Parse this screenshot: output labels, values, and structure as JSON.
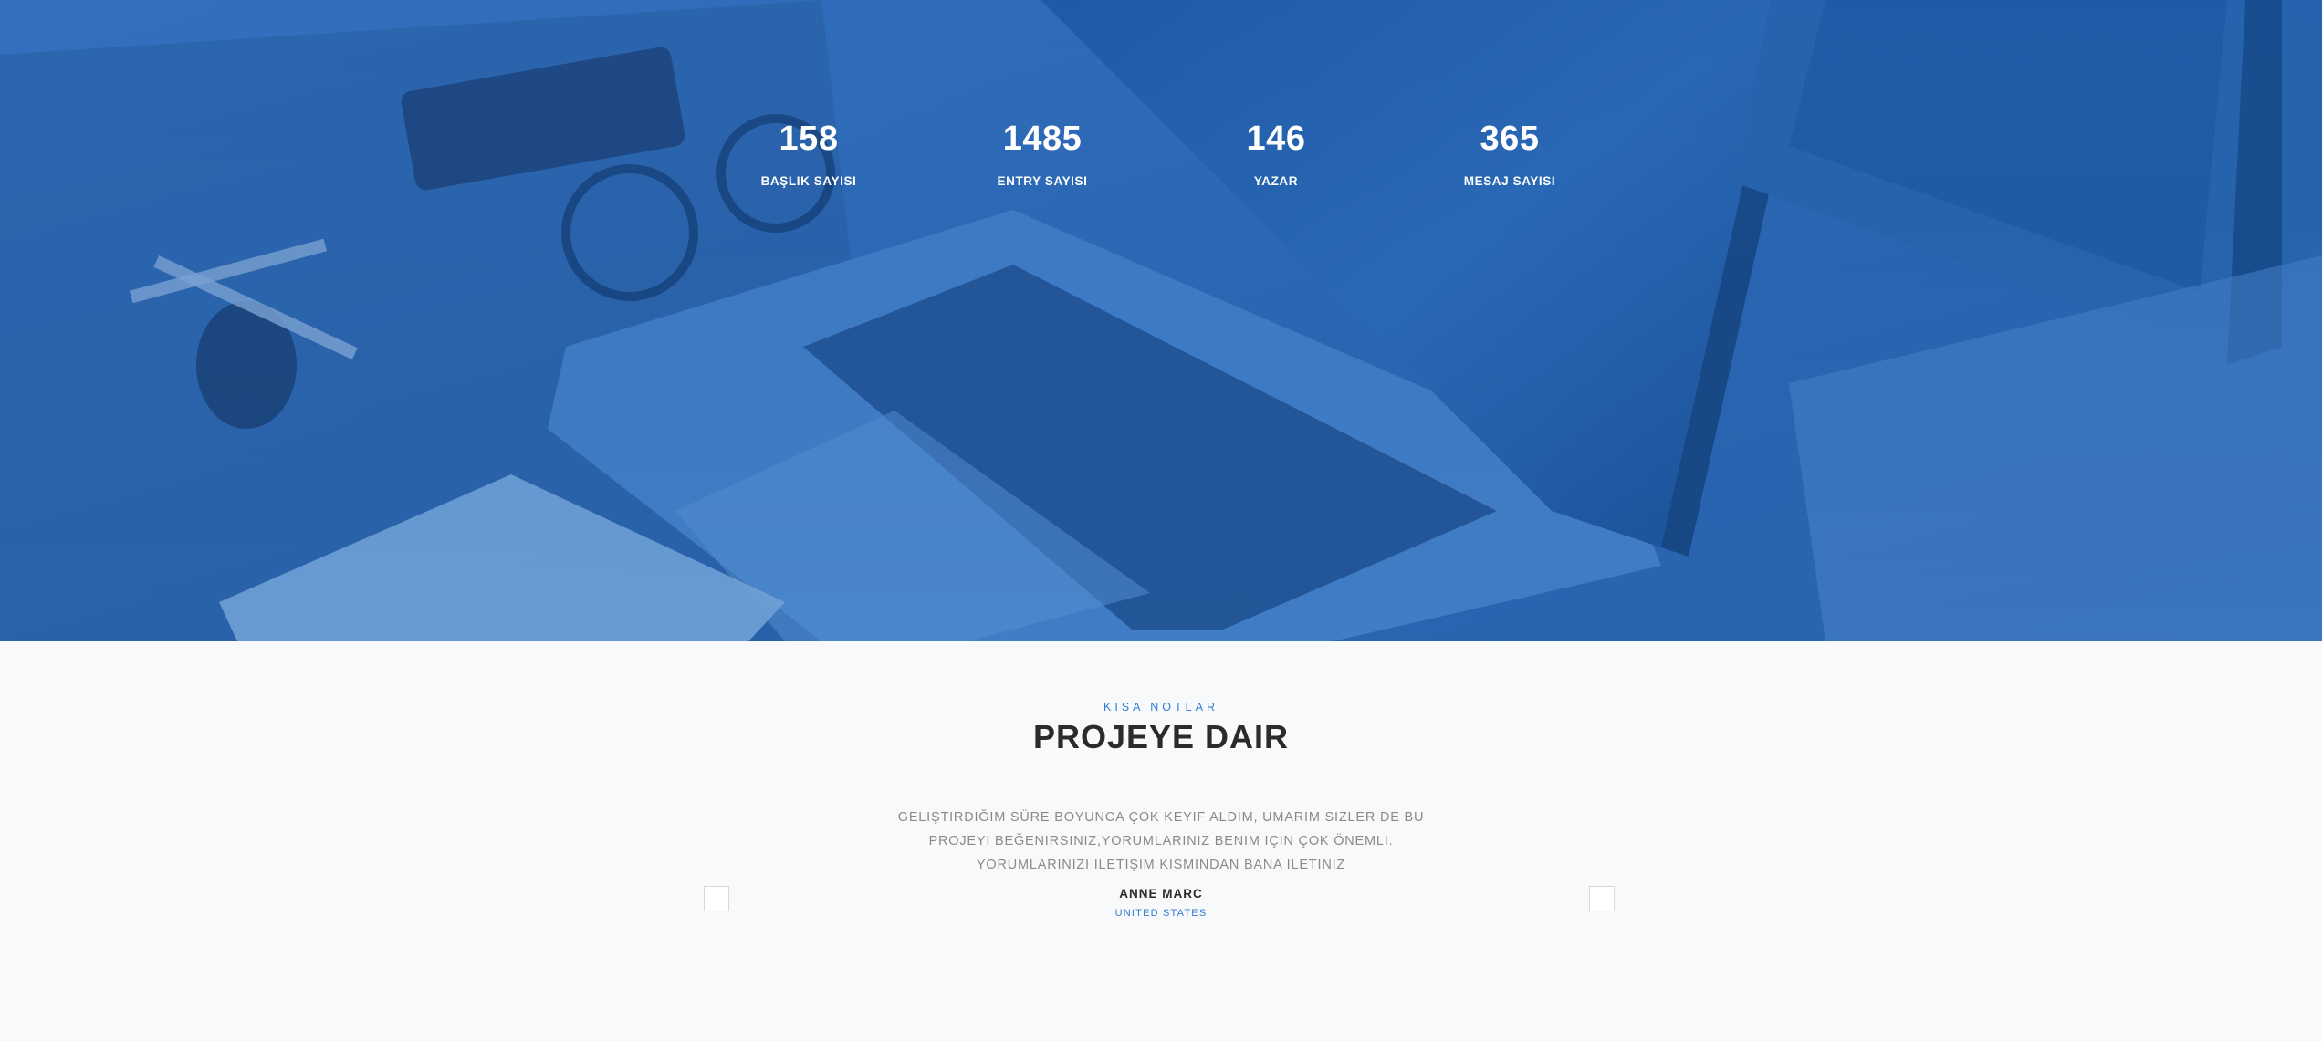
{
  "stats": {
    "items": [
      {
        "value": "158",
        "label": "BAŞLIK SAYISI"
      },
      {
        "value": "1485",
        "label": "ENTRY SAYISI"
      },
      {
        "value": "146",
        "label": "YAZAR"
      },
      {
        "value": "365",
        "label": "MESAJ SAYISI"
      }
    ],
    "overlay_color": "#2f6cb6",
    "text_color": "#ffffff"
  },
  "testimonials": {
    "eyebrow": "KISA NOTLAR",
    "title": "PROJEYE DAIR",
    "quote": "GELIŞTIRDIĞIM SÜRE BOYUNCA ÇOK KEYIF ALDIM, UMARIM SIZLER DE BU PROJEYI BEĞENIRSINIZ,YORUMLARINIZ BENIM IÇIN ÇOK ÖNEMLI. YORUMLARINIZI ILETIŞIM KISMINDAN BANA ILETINIZ",
    "author": "ANNE MARC",
    "country": "UNITED STATES",
    "prev_icon": "slider-prev-icon",
    "next_icon": "slider-next-icon",
    "accent_color": "#2f7cd3"
  }
}
